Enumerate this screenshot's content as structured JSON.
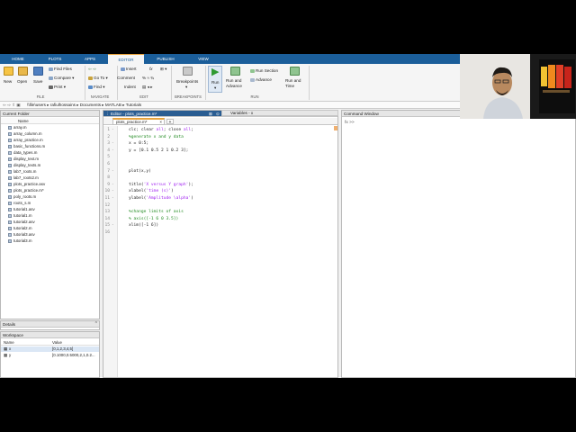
{
  "ribbon_tabs": [
    {
      "label": "HOME",
      "active": false
    },
    {
      "label": "PLOTS",
      "active": false
    },
    {
      "label": "APPS",
      "active": false
    },
    {
      "label": "EDITOR",
      "active": true
    },
    {
      "label": "PUBLISH",
      "active": false
    },
    {
      "label": "VIEW",
      "active": false
    }
  ],
  "ribbon": {
    "new": "New",
    "open": "Open",
    "save": "Save",
    "find_files": "Find Files",
    "compare": "Compare",
    "print": "Print",
    "insert": "Insert",
    "comment": "Comment",
    "indent": "Indent",
    "fx": "fx",
    "go_to": "Go To",
    "find": "Find",
    "breakpoints": "Breakpoints",
    "run": "Run",
    "run_and_advance": "Run and\nAdvance",
    "run_section": "Run Section",
    "advance": "Advance",
    "run_and_time": "Run and\nTime",
    "sections": [
      "FILE",
      "NAVIGATE",
      "EDIT",
      "BREAKPOINTS",
      "RUN"
    ]
  },
  "address": {
    "path": [
      "\\\\file\\users",
      "rafiulhossains",
      "Documents",
      "MATLAB",
      "Tutorials"
    ]
  },
  "current_folder": {
    "title": "Current Folder",
    "column": "Name",
    "files": [
      "array.m",
      "array_column.m",
      "array_practice.m",
      "basic_functions.m",
      "data_types.m",
      "display_text.m",
      "display_texts.m",
      "lab7_roots.m",
      "lab7_roots2.m",
      "plots_practice.asv",
      "plots_practice.m*",
      "poly_roots.m",
      "roots_s.m",
      "tutorial1.asv",
      "tutorial1.m",
      "tutorial2.asv",
      "tutorial2.m",
      "tutorial3.asv",
      "tutorial3.m"
    ]
  },
  "details": {
    "title": "Details"
  },
  "workspace": {
    "title": "Workspace",
    "col_name": "Name",
    "col_value": "Value",
    "vars": [
      {
        "name": "x",
        "value": "[0,1,2,3,4,5]"
      },
      {
        "name": "y",
        "value": "[0.1000,0.5000,2,1,0.2..."
      }
    ]
  },
  "editor": {
    "title": "Editor - plots_practice.m*",
    "variables_title": "Variables - x",
    "tab": "plots_practice.m*",
    "add_tab": "+",
    "lines": [
      {
        "n": "1",
        "dash": "-",
        "parts": [
          {
            "t": "clc; clear ",
            "c": ""
          },
          {
            "t": "all",
            "c": "str"
          },
          {
            "t": "; close ",
            "c": ""
          },
          {
            "t": "all",
            "c": "str"
          },
          {
            "t": ";",
            "c": ""
          }
        ]
      },
      {
        "n": "2",
        "dash": "",
        "parts": [
          {
            "t": "%generate x and y data",
            "c": "cmt"
          }
        ]
      },
      {
        "n": "3",
        "dash": "-",
        "parts": [
          {
            "t": "x = 0:5;",
            "c": ""
          }
        ]
      },
      {
        "n": "4",
        "dash": "-",
        "parts": [
          {
            "t": "y = [0.1 0.5 2 1 0.2 3];",
            "c": ""
          }
        ]
      },
      {
        "n": "5",
        "dash": "",
        "parts": []
      },
      {
        "n": "6",
        "dash": "",
        "parts": []
      },
      {
        "n": "7",
        "dash": "-",
        "parts": [
          {
            "t": "plot(x,y)",
            "c": ""
          }
        ]
      },
      {
        "n": "8",
        "dash": "",
        "parts": []
      },
      {
        "n": "9",
        "dash": "-",
        "parts": [
          {
            "t": "title(",
            "c": ""
          },
          {
            "t": "'X versus Y graph'",
            "c": "str"
          },
          {
            "t": ");",
            "c": ""
          }
        ]
      },
      {
        "n": "10",
        "dash": "-",
        "parts": [
          {
            "t": "xlabel(",
            "c": ""
          },
          {
            "t": "'time (s)'",
            "c": "str"
          },
          {
            "t": ")",
            "c": ""
          }
        ]
      },
      {
        "n": "11",
        "dash": "-",
        "parts": [
          {
            "t": "ylabel(",
            "c": ""
          },
          {
            "t": "'Amplitude \\alpha'",
            "c": "str"
          },
          {
            "t": ")",
            "c": ""
          }
        ]
      },
      {
        "n": "12",
        "dash": "",
        "parts": []
      },
      {
        "n": "13",
        "dash": "",
        "parts": [
          {
            "t": "%change limits of axis",
            "c": "cmt"
          }
        ]
      },
      {
        "n": "14",
        "dash": "",
        "parts": [
          {
            "t": "% axis([-1 6 0 3.5])",
            "c": "cmt"
          }
        ]
      },
      {
        "n": "15",
        "dash": "-",
        "parts": [
          {
            "t": "xlim([-1 6])",
            "c": ""
          }
        ]
      },
      {
        "n": "16",
        "dash": "",
        "parts": []
      }
    ]
  },
  "command_window": {
    "title": "Command Window",
    "prompt": "fx >>"
  },
  "colors": {
    "ribbon_blue": "#1b5e9a",
    "panel_title_blue": "#2a5d92",
    "editor_tab_accent": "#e8a33d"
  }
}
